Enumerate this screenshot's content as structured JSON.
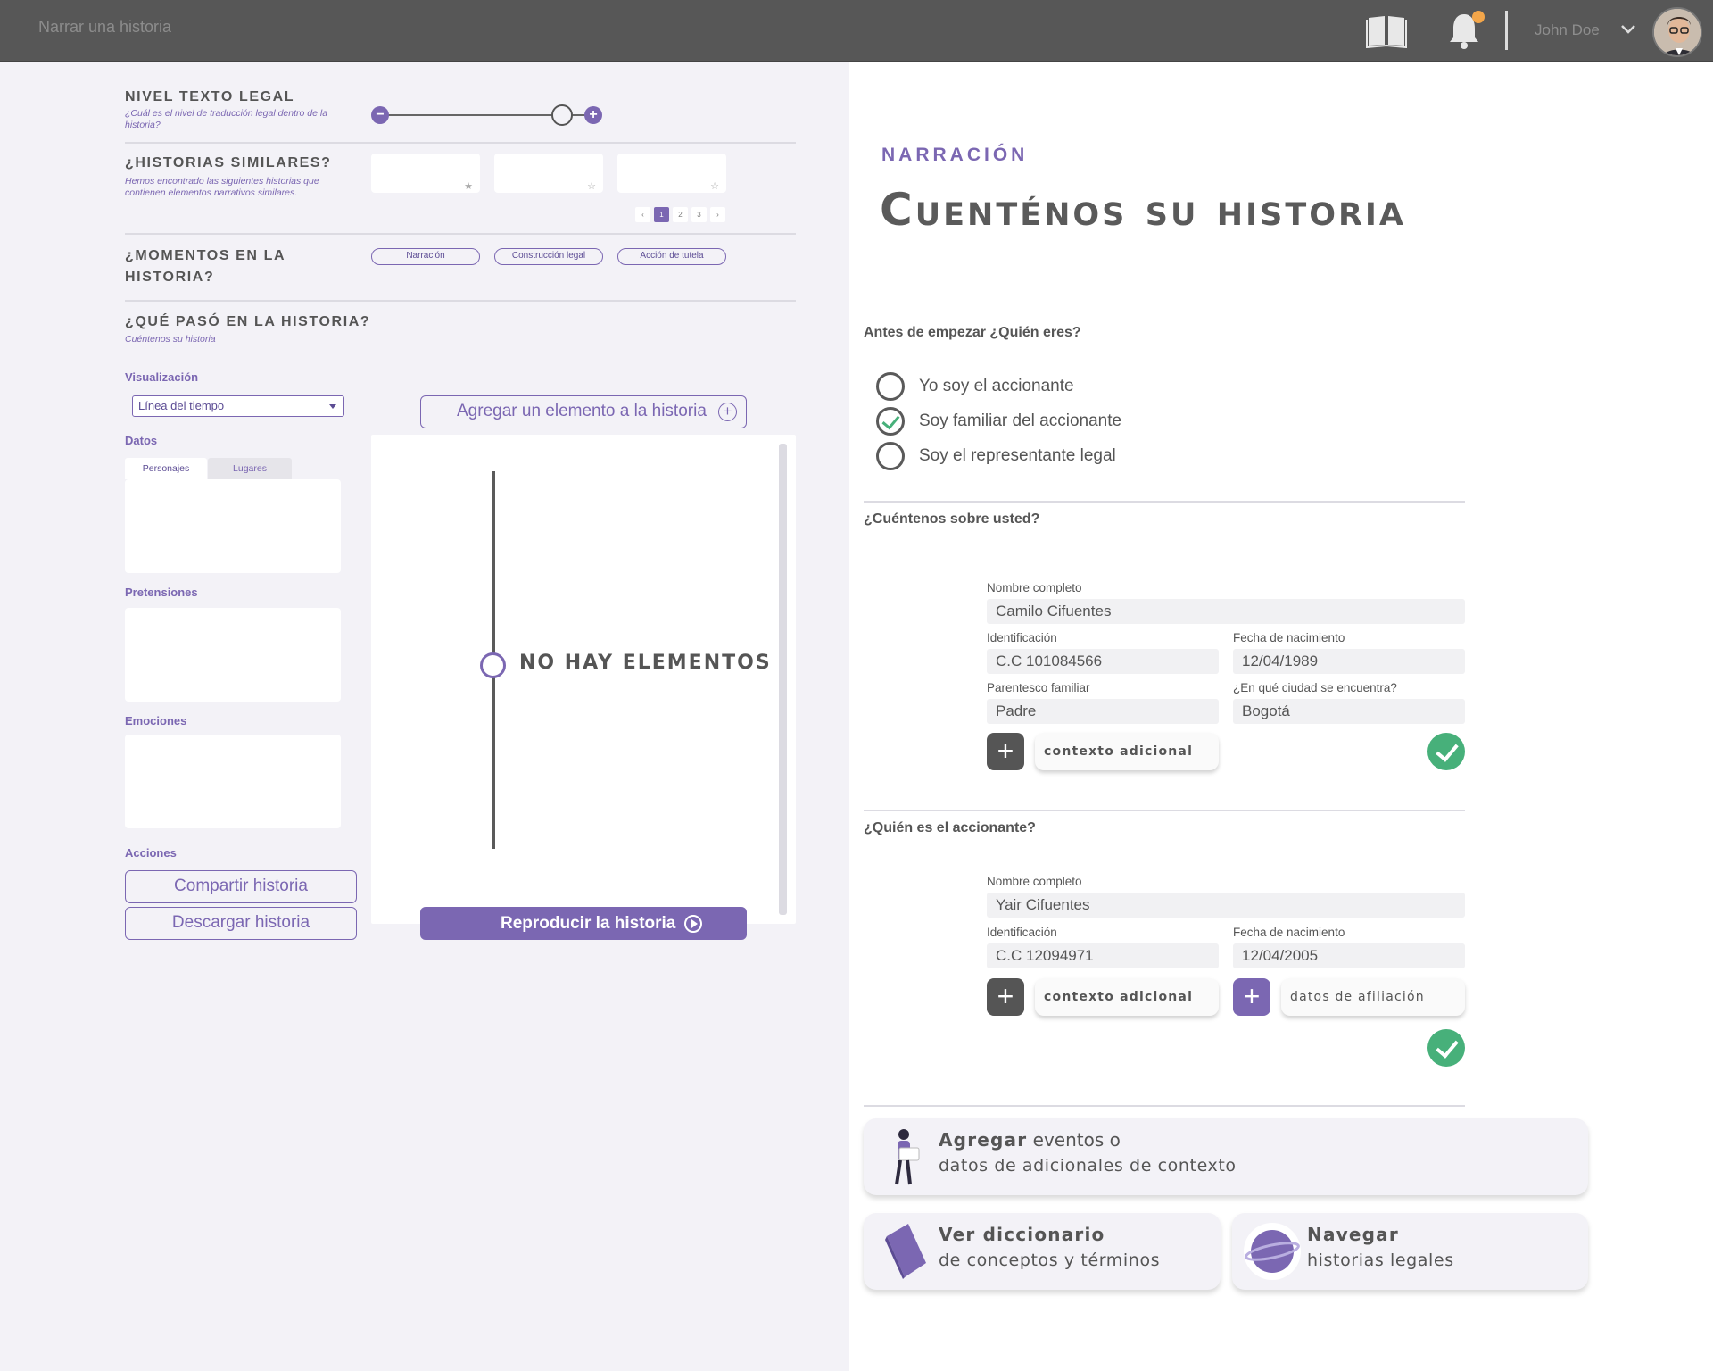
{
  "topbar": {
    "breadcrumb": "Narrar una historia",
    "user_name": "John Doe",
    "icons": [
      "book-icon",
      "bell-icon",
      "chevron-down-icon"
    ],
    "notification_dot_color": "#f3a64a"
  },
  "left": {
    "nivel": {
      "title": "NIVEL TEXTO LEGAL",
      "subtitle": "¿Cuál es el nivel de traducción legal dentro de la historia?",
      "level_fraction": 0.85
    },
    "similares": {
      "title": "¿HISTORIAS SIMILARES?",
      "subtitle": "Hemos encontrado las siguientes historias que contienen elementos narrativos similares.",
      "pages": [
        "‹",
        "1",
        "2",
        "3",
        "›"
      ],
      "stars": [
        "★",
        "☆",
        "☆"
      ]
    },
    "momentos": {
      "title": "¿MOMENTOS EN LA HISTORIA?",
      "pills": [
        "Narración",
        "Construcción legal",
        "Acción de tutela"
      ]
    },
    "que_paso": {
      "title": "¿QUÉ PASÓ EN LA HISTORIA?",
      "subtitle": "Cuéntenos su historia"
    },
    "visualizacion": {
      "label": "Visualización",
      "selected": "Línea del tiempo"
    },
    "datos": {
      "label": "Datos",
      "tabs": [
        "Personajes",
        "Lugares"
      ]
    },
    "pretensiones_label": "Pretensiones",
    "emociones_label": "Emociones",
    "acciones": {
      "label": "Acciones",
      "share": "Compartir historia",
      "download": "Descargar historia"
    },
    "add_element": "Agregar un elemento a la historia",
    "timeline_empty": "NO HAY ELEMENTOS",
    "play": "Reproducir la historia"
  },
  "right": {
    "eyebrow": "NARRACIÓN",
    "headline": "Cuenténos su historia",
    "who_question": "Antes de empezar ¿Quién eres?",
    "options": [
      {
        "label": "Yo soy el accionante",
        "checked": false
      },
      {
        "label": "Soy familiar del accionante",
        "checked": true
      },
      {
        "label": "Soy el representante legal",
        "checked": false
      }
    ],
    "about_question": "¿Cuéntenos sobre usted?",
    "about": {
      "nombre_label": "Nombre completo",
      "nombre": "Camilo Cifuentes",
      "id_label": "Identificación",
      "id": "C.C 101084566",
      "fecha_label": "Fecha de nacimiento",
      "fecha": "12/04/1989",
      "parentesco_label": "Parentesco familiar",
      "parentesco": "Padre",
      "ciudad_label": "¿En qué ciudad se encuentra?",
      "ciudad": "Bogotá",
      "contexto": "contexto adicional"
    },
    "accionante_question": "¿Quién es el accionante?",
    "accionante": {
      "nombre_label": "Nombre completo",
      "nombre": "Yair Cifuentes",
      "id_label": "Identificación",
      "id": "C.C 12094971",
      "fecha_label": "Fecha de nacimiento",
      "fecha": "12/04/2005",
      "contexto": "contexto adicional",
      "afiliacion": "datos de afiliación"
    },
    "cards": {
      "agregar_bold": "Agregar",
      "agregar_rest": " eventos o",
      "agregar_l2": "datos de adicionales de contexto",
      "dicc_bold": "Ver diccionario",
      "dicc_l2": "de conceptos y términos",
      "nav_bold": "Navegar",
      "nav_l2": "historias legales"
    }
  },
  "colors": {
    "accent": "#7b67b2",
    "success": "#47b07a",
    "topbar": "#575757"
  }
}
